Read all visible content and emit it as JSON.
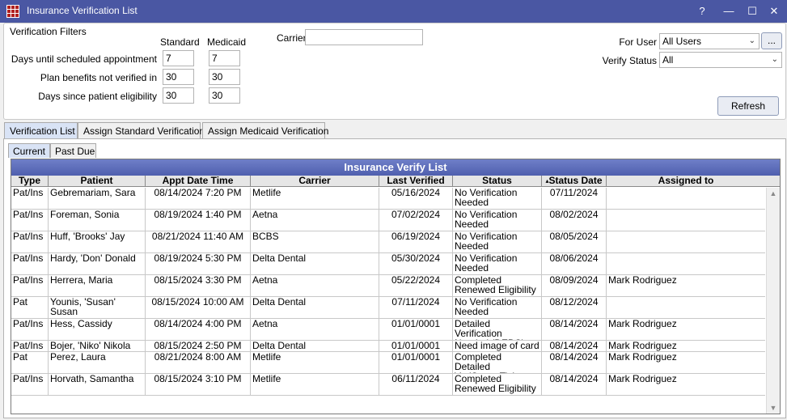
{
  "window": {
    "title": "Insurance Verification List",
    "controls": {
      "help": "?",
      "minimize": "—",
      "maximize": "☐",
      "close": "✕"
    }
  },
  "filters": {
    "group_title": "Verification Filters",
    "col_standard": "Standard",
    "col_medicaid": "Medicaid",
    "rows": [
      {
        "label": "Days until scheduled appointment",
        "standard": "7",
        "medicaid": "7"
      },
      {
        "label": "Plan benefits not verified in",
        "standard": "30",
        "medicaid": "30"
      },
      {
        "label": "Days since patient eligibility",
        "standard": "30",
        "medicaid": "30"
      }
    ],
    "carrier_label": "Carrier",
    "carrier_value": "",
    "for_user_label": "For User",
    "for_user_value": "All Users",
    "ellipsis_label": "...",
    "verify_status_label": "Verify Status",
    "verify_status_value": "All",
    "refresh_label": "Refresh"
  },
  "tabs": [
    "Verification List",
    "Assign Standard Verification",
    "Assign Medicaid Verification"
  ],
  "subtabs": [
    "Current",
    "Past Due"
  ],
  "grid": {
    "title": "Insurance Verify List",
    "columns": [
      "Type",
      "Patient",
      "Appt Date Time",
      "Carrier",
      "Last Verified",
      "Status",
      "Status Date",
      "Assigned to"
    ],
    "sort_indicator": "▴",
    "rows": [
      {
        "type": "Pat/Ins",
        "patient": "Gebremariam, Sara",
        "appt": "08/14/2024 7:20 PM",
        "carrier": "Metlife",
        "last": "05/16/2024",
        "status": [
          "No Verification",
          "Needed"
        ],
        "status_date": "07/11/2024",
        "assigned": ""
      },
      {
        "type": "Pat/Ins",
        "patient": "Foreman, Sonia",
        "appt": "08/19/2024 1:40 PM",
        "carrier": "Aetna",
        "last": "07/02/2024",
        "status": [
          "No Verification",
          "Needed"
        ],
        "status_date": "08/02/2024",
        "assigned": ""
      },
      {
        "type": "Pat/Ins",
        "patient": "Huff, 'Brooks' Jay",
        "appt": "08/21/2024 11:40 AM",
        "carrier": "BCBS",
        "last": "06/19/2024",
        "status": [
          "No Verification",
          "Needed"
        ],
        "status_date": "08/05/2024",
        "assigned": ""
      },
      {
        "type": "Pat/Ins",
        "patient": "Hardy, 'Don' Donald",
        "appt": "08/19/2024 5:30 PM",
        "carrier": "Delta Dental",
        "last": "05/30/2024",
        "status": [
          "No Verification",
          "Needed"
        ],
        "status_date": "08/06/2024",
        "assigned": ""
      },
      {
        "type": "Pat/Ins",
        "patient": "Herrera, Maria",
        "appt": "08/15/2024 3:30 PM",
        "carrier": "Aetna",
        "last": "05/22/2024",
        "status": [
          "Completed",
          "Renewed Eligibility"
        ],
        "status_date": "08/09/2024",
        "assigned": "Mark Rodriguez"
      },
      {
        "type": "Pat",
        "patient": "Younis, 'Susan' Susan",
        "appt": "08/15/2024 10:00 AM",
        "carrier": "Delta Dental",
        "last": "07/11/2024",
        "status": [
          "No Verification",
          "Needed"
        ],
        "status_date": "08/12/2024",
        "assigned": ""
      },
      {
        "type": "Pat/Ins",
        "patient": "Hess, Cassidy",
        "appt": "08/14/2024 4:00 PM",
        "carrier": "Aetna",
        "last": "01/01/0001",
        "status": [
          "Detailed Verification",
          "Needed (DEBC)"
        ],
        "status_date": "08/14/2024",
        "assigned": "Mark Rodriguez"
      },
      {
        "type": "Pat/Ins",
        "patient": "Bojer, 'Niko' Nikola",
        "appt": "08/15/2024 2:50 PM",
        "carrier": "Delta Dental",
        "last": "01/01/0001",
        "status": [
          "Need image of card"
        ],
        "status_date": "08/14/2024",
        "assigned": "Mark Rodriguez"
      },
      {
        "type": "Pat",
        "patient": "Perez, Laura",
        "appt": "08/21/2024 8:00 AM",
        "carrier": "Metlife",
        "last": "01/01/0001",
        "status": [
          "Completed Detailed",
          "VeriSmart Ticket"
        ],
        "status_date": "08/14/2024",
        "assigned": "Mark Rodriguez"
      },
      {
        "type": "Pat/Ins",
        "patient": "Horvath, Samantha",
        "appt": "08/15/2024 3:10 PM",
        "carrier": "Metlife",
        "last": "06/11/2024",
        "status": [
          "Completed",
          "Renewed Eligibility"
        ],
        "status_date": "08/14/2024",
        "assigned": "Mark Rodriguez"
      }
    ]
  },
  "colors": {
    "titlebar": "#4a57a3",
    "grid_title": "#5a6ab8",
    "active_tab": "#d9e3f5"
  }
}
